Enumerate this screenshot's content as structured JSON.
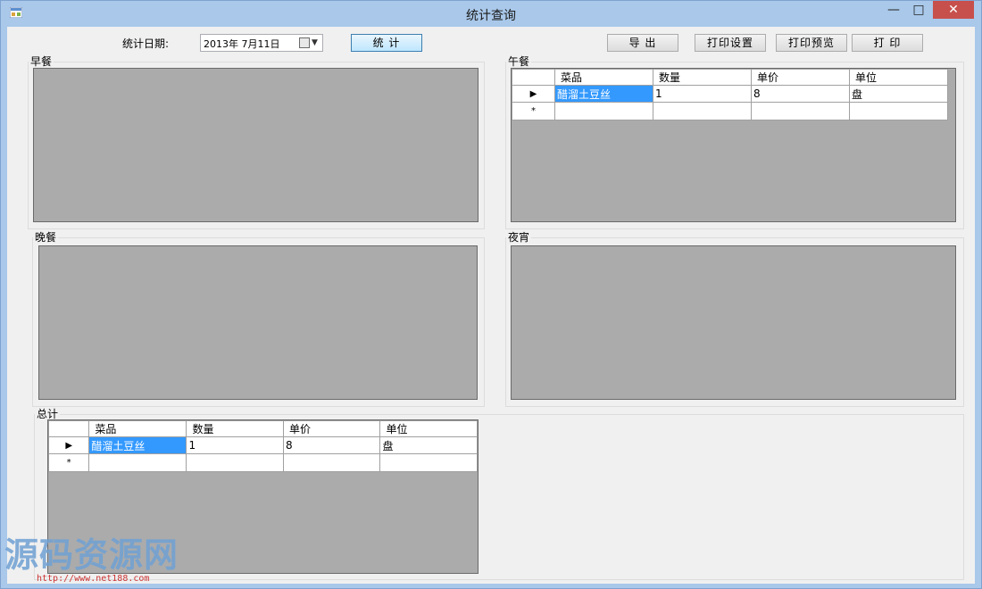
{
  "window": {
    "title": "统计查询",
    "min_glyph": "—",
    "max_glyph": "□",
    "close_glyph": "✕"
  },
  "toolbar": {
    "date_label": "统计日期:",
    "date_value": "2013年  7月11日",
    "stat_label": "统 计",
    "export_label": "导 出",
    "print_settings_label": "打印设置",
    "print_preview_label": "打印预览",
    "print_label": "打 印"
  },
  "groups": {
    "breakfast": "早餐",
    "lunch": "午餐",
    "dinner": "晚餐",
    "night_snack": "夜宵",
    "total": "总计"
  },
  "grid": {
    "columns": [
      "菜品",
      "数量",
      "单价",
      "单位"
    ],
    "row_indicator": "▶",
    "new_row_indicator": "*"
  },
  "lunch_rows": [
    {
      "dish": "醋溜土豆丝",
      "qty": "1",
      "price": "8",
      "unit": "盘"
    }
  ],
  "total_rows": [
    {
      "dish": "醋溜土豆丝",
      "qty": "1",
      "price": "8",
      "unit": "盘"
    }
  ],
  "watermark": {
    "text": "源码资源网",
    "url": "http://www.net188.com"
  },
  "colors": {
    "accent": "#3399ff",
    "grid_bg": "#ababab",
    "close_red": "#c7504c"
  }
}
